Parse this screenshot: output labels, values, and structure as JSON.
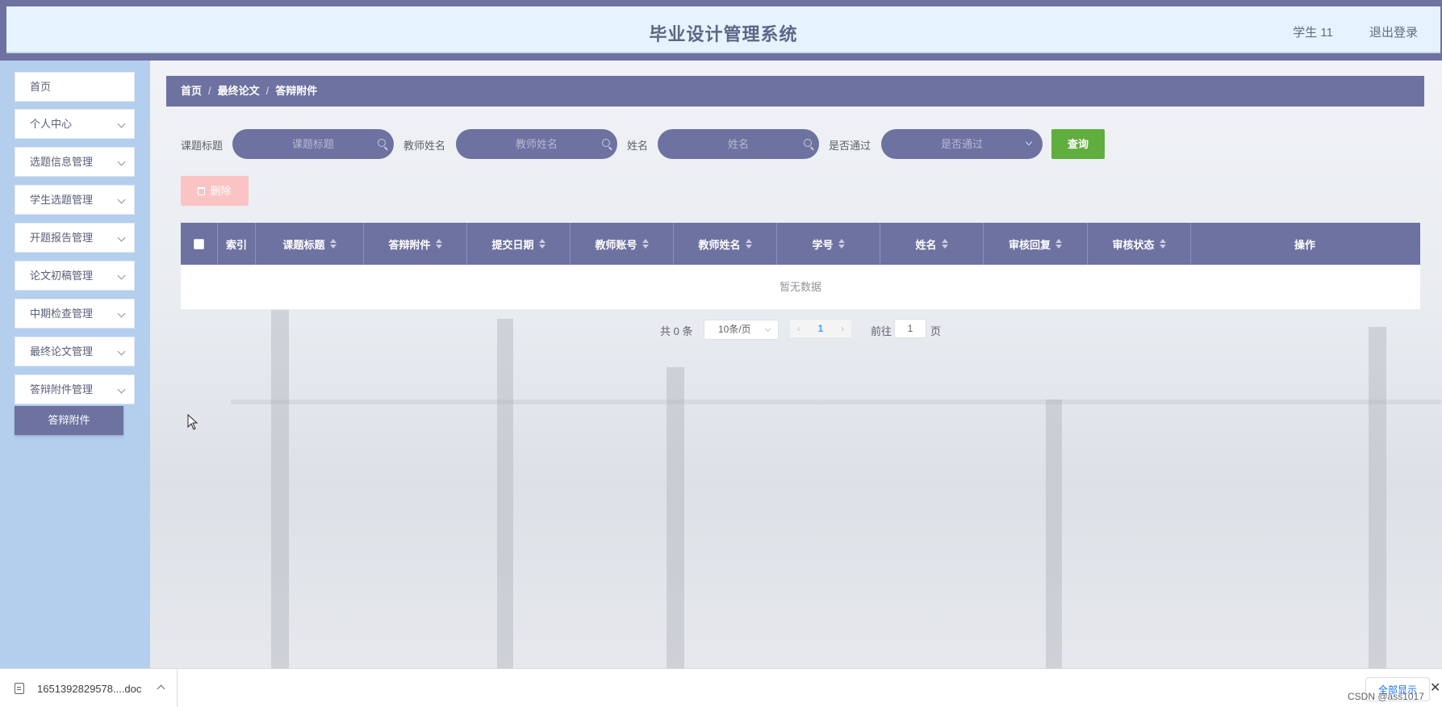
{
  "header": {
    "title": "毕业设计管理系统",
    "user": "学生 11",
    "logout": "退出登录"
  },
  "sidebar": {
    "items": [
      {
        "label": "首页"
      },
      {
        "label": "个人中心"
      },
      {
        "label": "选题信息管理"
      },
      {
        "label": "学生选题管理"
      },
      {
        "label": "开题报告管理"
      },
      {
        "label": "论文初稿管理"
      },
      {
        "label": "中期检查管理"
      },
      {
        "label": "最终论文管理"
      },
      {
        "label": "答辩附件管理"
      }
    ],
    "active_sub": "答辩附件"
  },
  "breadcrumb": {
    "home": "首页",
    "parent": "最终论文",
    "current": "答辩附件"
  },
  "search": {
    "title_label": "课题标题",
    "title_placeholder": "课题标题",
    "teacher_label": "教师姓名",
    "teacher_placeholder": "教师姓名",
    "name_label": "姓名",
    "name_placeholder": "姓名",
    "passed_label": "是否通过",
    "passed_placeholder": "是否通过",
    "query": "查询"
  },
  "toolbar": {
    "delete": "删除"
  },
  "table": {
    "columns": [
      "索引",
      "课题标题",
      "答辩附件",
      "提交日期",
      "教师账号",
      "教师姓名",
      "学号",
      "姓名",
      "审核回复",
      "审核状态",
      "操作"
    ],
    "empty": "暂无数据"
  },
  "pagination": {
    "total": "共 0 条",
    "page_size": "10条/页",
    "current_page": "1",
    "goto": "前往",
    "goto_value": "1",
    "unit": "页"
  },
  "download_bar": {
    "file_name": "1651392829578....doc",
    "show_all": "全部显示",
    "watermark": "CSDN @ass1017",
    "close": "✕"
  },
  "colors": {
    "accent": "#6e72a0",
    "sidebar_bg": "#b4cfee",
    "query_button": "#5fae3e",
    "delete_button": "#fbc4c4"
  }
}
